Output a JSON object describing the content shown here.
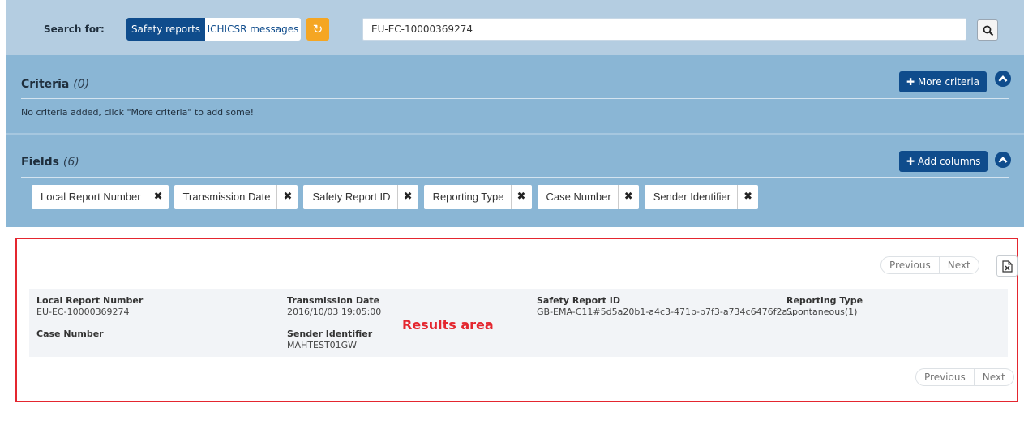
{
  "search": {
    "label": "Search for:",
    "tabs": [
      "Safety reports",
      "ICHICSR messages"
    ],
    "active_tab": "Safety reports",
    "reset_icon": "undo-icon",
    "query": "EU-EC-10000369274",
    "search_icon": "magnifier-icon"
  },
  "criteria": {
    "title": "Criteria",
    "count": "(0)",
    "more_button_icon": "plus-icon",
    "more_button": "More criteria",
    "hint": "No criteria added, click \"More criteria\" to add some!",
    "toggle_icon": "chevron-up-icon"
  },
  "fields": {
    "title": "Fields",
    "count": "(6)",
    "add_button": "Add columns",
    "chips": [
      "Local Report Number",
      "Transmission Date",
      "Safety Report ID",
      "Reporting Type",
      "Case Number",
      "Sender Identifier"
    ],
    "remove_icon": "close-icon"
  },
  "results": {
    "pager_top": {
      "previous": "Previous",
      "next": "Next"
    },
    "pager_bottom": {
      "previous": "Previous",
      "next": "Next"
    },
    "export_icon": "excel-export-icon",
    "callout": "Results area",
    "row": {
      "local_report_number": {
        "label": "Local Report Number",
        "value": "EU-EC-10000369274"
      },
      "transmission_date": {
        "label": "Transmission Date",
        "value": "2016/10/03 19:05:00"
      },
      "safety_report_id": {
        "label": "Safety Report ID",
        "value": "GB-EMA-C11#5d5a20b1-a4c3-471b-b7f3-a734c6476f2a..."
      },
      "reporting_type": {
        "label": "Reporting Type",
        "value": "Spontaneous(1)"
      },
      "case_number": {
        "label": "Case Number",
        "value": ""
      },
      "sender_identifier": {
        "label": "Sender Identifier",
        "value": "MAHTEST01GW"
      }
    }
  },
  "colors": {
    "header_bg": "#b4cde1",
    "panel_bg": "#8ab6d5",
    "primary": "#0f4c8c",
    "reset": "#f5a623",
    "highlight": "#e4262f"
  }
}
